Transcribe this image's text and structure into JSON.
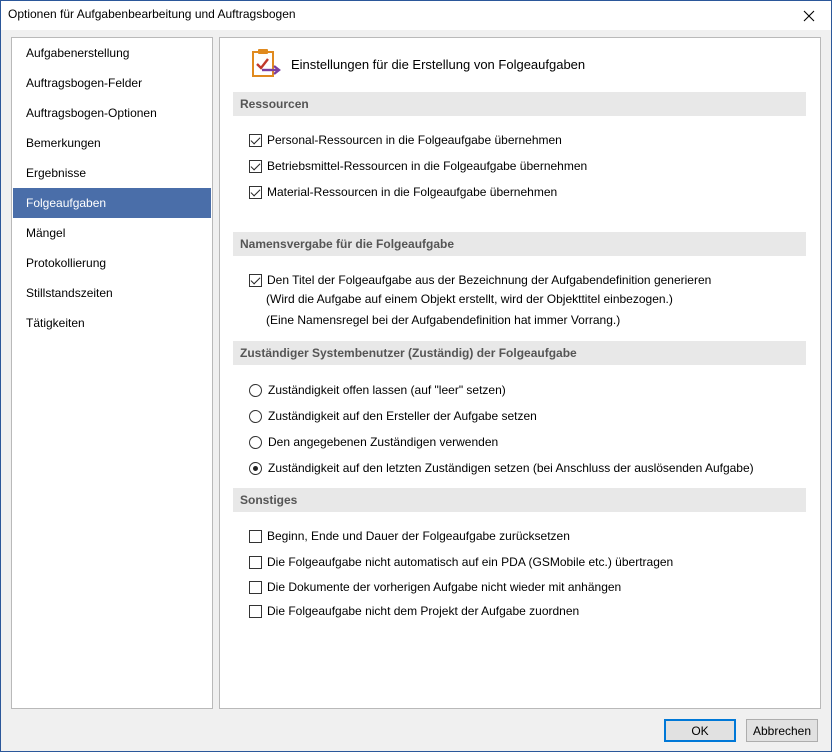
{
  "window": {
    "title": "Optionen für Aufgabenbearbeitung und Auftragsbogen",
    "close_symbol": "✕"
  },
  "sidebar": {
    "selected_index": 5,
    "items": [
      {
        "label": "Aufgabenerstellung"
      },
      {
        "label": "Auftragsbogen-Felder"
      },
      {
        "label": "Auftragsbogen-Optionen"
      },
      {
        "label": "Bemerkungen"
      },
      {
        "label": "Ergebnisse"
      },
      {
        "label": "Folgeaufgaben"
      },
      {
        "label": "Mängel"
      },
      {
        "label": "Protokollierung"
      },
      {
        "label": "Stillstandszeiten"
      },
      {
        "label": "Tätigkeiten"
      }
    ]
  },
  "main": {
    "header_icon": "clipboard-check-arrow-icon",
    "title": "Einstellungen für die Erstellung von Folgeaufgaben",
    "sections": {
      "ressourcen": {
        "title": "Ressourcen",
        "options": [
          {
            "label": "Personal-Ressourcen in die Folgeaufgabe übernehmen",
            "checked": true
          },
          {
            "label": "Betriebsmittel-Ressourcen in die Folgeaufgabe übernehmen",
            "checked": true
          },
          {
            "label": "Material-Ressourcen in die Folgeaufgabe übernehmen",
            "checked": true
          }
        ]
      },
      "namensvergabe": {
        "title": "Namensvergabe für die Folgeaufgabe",
        "option": {
          "label": "Den Titel der Folgeaufgabe aus der Bezeichnung der Aufgabendefinition generieren",
          "checked": true
        },
        "note1": "(Wird die Aufgabe auf einem Objekt erstellt, wird der Objekttitel einbezogen.)",
        "note2": "(Eine Namensregel bei der Aufgabendefinition hat immer Vorrang.)"
      },
      "zustaendig": {
        "title": "Zuständiger Systembenutzer (Zuständig) der Folgeaufgabe",
        "selected_index": 3,
        "options": [
          {
            "label": "Zuständigkeit offen lassen (auf \"leer\" setzen)"
          },
          {
            "label": "Zuständigkeit auf den Ersteller der Aufgabe setzen"
          },
          {
            "label": "Den angegebenen Zuständigen verwenden"
          },
          {
            "label": "Zuständigkeit auf den letzten Zuständigen setzen (bei Anschluss der auslösenden Aufgabe)"
          }
        ]
      },
      "sonstiges": {
        "title": "Sonstiges",
        "options": [
          {
            "label": "Beginn, Ende und Dauer der Folgeaufgabe zurücksetzen",
            "checked": false
          },
          {
            "label": "Die Folgeaufgabe nicht automatisch auf ein PDA (GSMobile etc.) übertragen",
            "checked": false
          },
          {
            "label": "Die Dokumente der vorherigen Aufgabe nicht wieder mit anhängen",
            "checked": false
          },
          {
            "label": "Die Folgeaufgabe nicht dem Projekt der Aufgabe zuordnen",
            "checked": false
          }
        ]
      }
    }
  },
  "buttons": {
    "ok": "OK",
    "cancel": "Abbrechen"
  },
  "colors": {
    "selected_bg": "#4a6ea9",
    "section_bg": "#e8e8e8",
    "window_border": "#2b579a",
    "default_button_border": "#0078d7"
  }
}
